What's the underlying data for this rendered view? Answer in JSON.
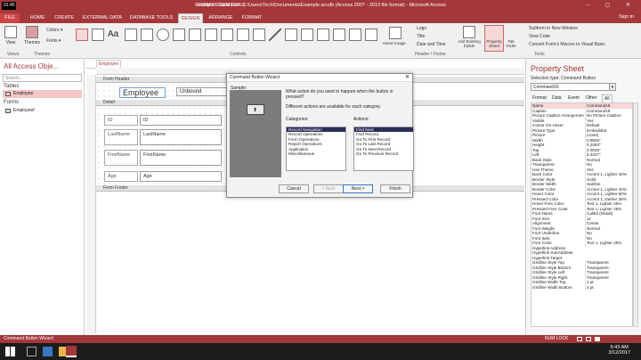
{
  "recorder": "01:45",
  "window": {
    "title": "Example : Database- C:\\Users\\Tech\\Documents\\Example.accdb (Access 2007 - 2013 file format) - Microsoft Access",
    "context_tab_group": "FORM DESIGN TOOLS",
    "help": "?",
    "controls": "–  ▢  ✕",
    "sign_in": "Sign in"
  },
  "ribbon_tabs": [
    "FILE",
    "HOME",
    "CREATE",
    "EXTERNAL DATA",
    "DATABASE TOOLS",
    "DESIGN",
    "ARRANGE",
    "FORMAT"
  ],
  "ribbon": {
    "view": "View",
    "themes": "Themes",
    "colors": "Colors ▾",
    "fonts": "Fonts ▾",
    "insert_image": "Insert Image",
    "logo": "Logo",
    "title": "Title",
    "date_time": "Date and Time",
    "add_existing_fields": "Add Existing Fields",
    "property_sheet": "Property Sheet",
    "tab_order": "Tab Order",
    "subform_new_window": "Subform in New Window",
    "view_code": "View Code",
    "convert_macros": "Convert Form's Macros to Visual Basic",
    "groups": {
      "views": "Views",
      "themes": "Themes",
      "controls": "Controls",
      "header_footer": "Header / Footer",
      "tools": "Tools"
    }
  },
  "nav_pane": {
    "title": "All Access Obje...",
    "search_placeholder": "Search...",
    "sections": [
      {
        "label": "Tables",
        "items": [
          "Employee"
        ]
      },
      {
        "label": "Forms",
        "items": [
          "Employeef"
        ]
      }
    ]
  },
  "document": {
    "tab": "Employee",
    "form_header": "Form Header",
    "detail": "Detail",
    "form_footer": "Form Footer",
    "title_label": "Employee",
    "unbound": "Unbound",
    "fields": [
      {
        "label": "ID",
        "box": "ID"
      },
      {
        "label": "LastName",
        "box": "LastName"
      },
      {
        "label": "FirstName",
        "box": "FirstName"
      },
      {
        "label": "Age",
        "box": "Age"
      }
    ]
  },
  "dialog": {
    "title": "Command Button Wizard",
    "close": "✕",
    "sample_label": "Sample:",
    "question": "What action do you want to happen when the button is pressed?",
    "hint": "Different actions are available for each category.",
    "categories_label": "Categories:",
    "actions_label": "Actions:",
    "categories": [
      "Record Navigation",
      "Record Operations",
      "Form Operations",
      "Report Operations",
      "Application",
      "Miscellaneous"
    ],
    "actions": [
      "Find Next",
      "Find Record",
      "Go To First Record",
      "Go To Last Record",
      "Go To Next Record",
      "Go To Previous Record"
    ],
    "buttons": {
      "cancel": "Cancel",
      "back": "< Back",
      "next": "Next >",
      "finish": "Finish"
    }
  },
  "property_sheet": {
    "title": "Property Sheet",
    "selection_label": "Selection type: Command Button",
    "selected": "Command16",
    "tabs": [
      "Format",
      "Data",
      "Event",
      "Other",
      "All"
    ],
    "active_tab": "All",
    "rows": [
      [
        "Name",
        "Command16"
      ],
      [
        "Caption",
        "Command16"
      ],
      [
        "Picture Caption Arrangement",
        "No Picture Caption"
      ],
      [
        "Visible",
        "Yes"
      ],
      [
        "Cursor On Hover",
        "Default"
      ],
      [
        "Picture Type",
        "Embedded"
      ],
      [
        "Picture",
        "(none)"
      ],
      [
        "Width",
        "0.9583\""
      ],
      [
        "Height",
        "0.2083\""
      ],
      [
        "Top",
        "0.0833\""
      ],
      [
        "Left",
        "5.3417\""
      ],
      [
        "Back Style",
        "Normal"
      ],
      [
        "Transparent",
        "No"
      ],
      [
        "Use Theme",
        "Yes"
      ],
      [
        "Back Color",
        "Accent 1, Lighter 40%"
      ],
      [
        "Border Style",
        "Solid"
      ],
      [
        "Border Width",
        "Hairline"
      ],
      [
        "Border Color",
        "Accent 1, Lighter 40%"
      ],
      [
        "Hover Color",
        "Accent 1, Lighter 60%"
      ],
      [
        "Pressed Color",
        "Accent 1, Darker 25%"
      ],
      [
        "Hover Fore Color",
        "Text 1, Lighter 25%"
      ],
      [
        "Pressed Fore Color",
        "Text 1, Lighter 25%"
      ],
      [
        "Font Name",
        "Calibri (Detail)"
      ],
      [
        "Font Size",
        "11"
      ],
      [
        "Alignment",
        "Center"
      ],
      [
        "Font Weight",
        "Normal"
      ],
      [
        "Font Underline",
        "No"
      ],
      [
        "Font Italic",
        "No"
      ],
      [
        "Fore Color",
        "Text 1, Lighter 25%"
      ],
      [
        "Hyperlink Address",
        ""
      ],
      [
        "Hyperlink SubAddress",
        ""
      ],
      [
        "Hyperlink Target",
        ""
      ],
      [
        "Gridline Style Top",
        "Transparent"
      ],
      [
        "Gridline Style Bottom",
        "Transparent"
      ],
      [
        "Gridline Style Left",
        "Transparent"
      ],
      [
        "Gridline Style Right",
        "Transparent"
      ],
      [
        "Gridline Width Top",
        "1 pt"
      ],
      [
        "Gridline Width Bottom",
        "1 pt"
      ]
    ]
  },
  "status": {
    "left": "Command Button Wizard",
    "num_lock": "NUM LOCK"
  },
  "taskbar": {
    "time": "5:43 AM",
    "date": "3/12/2017"
  },
  "colors": {
    "accent": "#a4373a",
    "selection": "#2d2d5a"
  }
}
